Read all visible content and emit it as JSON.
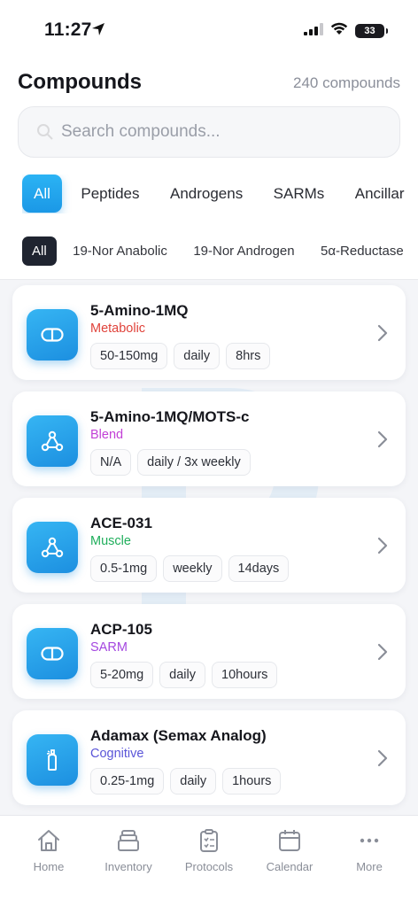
{
  "status_bar": {
    "time": "11:27",
    "battery": "33"
  },
  "header": {
    "title": "Compounds",
    "count": "240 compounds",
    "search_placeholder": "Search compounds..."
  },
  "tabs": [
    "All",
    "Peptides",
    "Androgens",
    "SARMs",
    "Ancillar"
  ],
  "subtabs": [
    "All",
    "19-Nor Anabolic",
    "19-Nor Androgen",
    "5α-Reductase"
  ],
  "compounds": [
    {
      "name": "5-Amino-1MQ",
      "category": "Metabolic",
      "category_color": "#e0433b",
      "icon": "capsule-icon",
      "dose": "50-150mg",
      "frequency": "daily",
      "half_life": "8hrs"
    },
    {
      "name": "5-Amino-1MQ/MOTS-c",
      "category": "Blend",
      "category_color": "#c23fd6",
      "icon": "molecule-icon",
      "dose": "N/A",
      "frequency": "daily / 3x weekly"
    },
    {
      "name": "ACE-031",
      "category": "Muscle",
      "category_color": "#1fae5b",
      "icon": "molecule-icon",
      "dose": "0.5-1mg",
      "frequency": "weekly",
      "half_life": "14days"
    },
    {
      "name": "ACP-105",
      "category": "SARM",
      "category_color": "#a447e0",
      "icon": "capsule-icon",
      "dose": "5-20mg",
      "frequency": "daily",
      "half_life": "10hours"
    },
    {
      "name": "Adamax (Semax Analog)",
      "category": "Cognitive",
      "category_color": "#5a55d8",
      "icon": "spray-bottle-icon",
      "dose": "0.25-1mg",
      "frequency": "daily",
      "half_life": "1hours"
    }
  ],
  "tabbar": {
    "home": "Home",
    "inventory": "Inventory",
    "protocols": "Protocols",
    "calendar": "Calendar",
    "more": "More"
  },
  "colors": {
    "accent": "#1b98e6",
    "dark_chip": "#1f2430"
  }
}
